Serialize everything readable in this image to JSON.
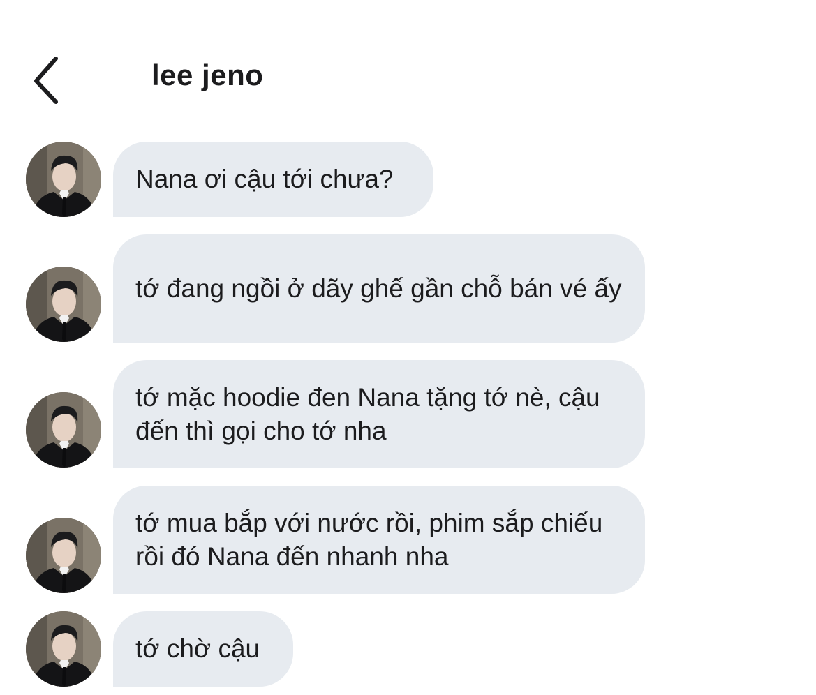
{
  "header": {
    "title": "lee jeno",
    "back_icon": "chevron-left-icon"
  },
  "messages": [
    {
      "text": "Nana ơi cậu tới chưa?"
    },
    {
      "text": "tớ đang ngồi ở dãy ghế gần chỗ bán vé ấy"
    },
    {
      "text": "tớ mặc hoodie đen Nana tặng tớ nè, cậu đến thì gọi cho tớ nha"
    },
    {
      "text": "tớ mua bắp với nước rồi, phim sắp chiếu rồi đó Nana đến nhanh nha"
    },
    {
      "text": "tớ chờ cậu"
    }
  ],
  "colors": {
    "bubble": "#e7ebf0",
    "text": "#1c1c1e",
    "background": "#ffffff"
  }
}
